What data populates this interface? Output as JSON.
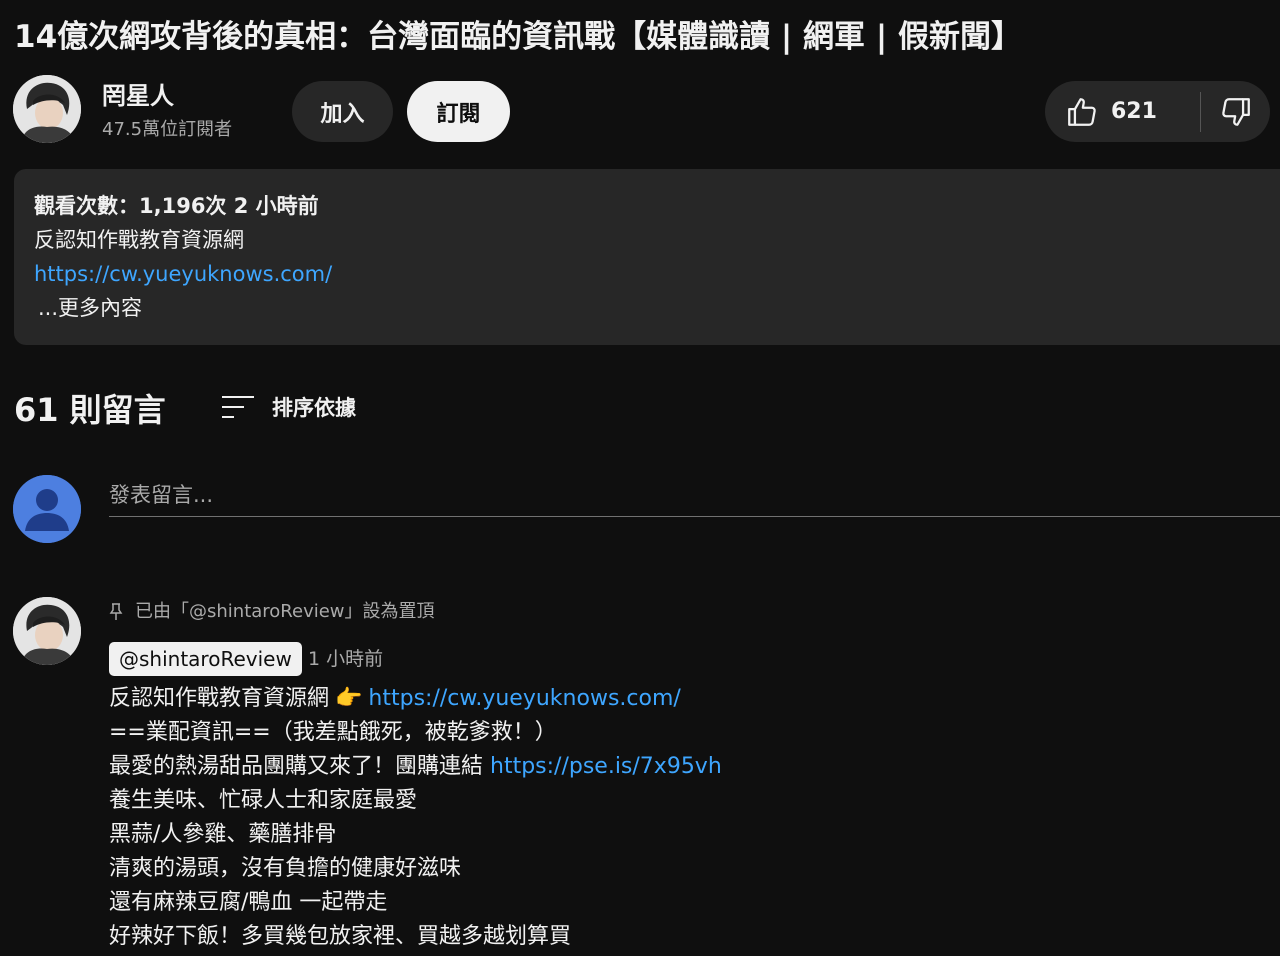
{
  "video": {
    "title": "14億次網攻背後的真相：台灣面臨的資訊戰【媒體識讀 | 網軍 | 假新聞】"
  },
  "channel": {
    "name": "罔星人",
    "subscribers": "47.5萬位訂閱者",
    "join_label": "加入",
    "subscribe_label": "訂閱"
  },
  "actions": {
    "like_count": "621",
    "like_icon": "thumbs-up-icon",
    "dislike_icon": "thumbs-down-icon"
  },
  "description": {
    "meta": "觀看次數：1,196次  2 小時前",
    "text": "反認知作戰教育資源網",
    "link": "https://cw.yueyuknows.com/",
    "more_label": "...更多內容"
  },
  "comments": {
    "count_label": "61 則留言",
    "sort_label": "排序依據",
    "input_placeholder": "發表留言...",
    "pinned_comment": {
      "pinned_note": "已由「@shintaroReview」設為置頂",
      "author": "@shintaroReview",
      "time": "1 小時前",
      "line1_text": "反認知作戰教育資源網",
      "line1_emoji": "👉",
      "line1_link": "https://cw.yueyuknows.com/",
      "line2": "==業配資訊==（我差點餓死，被乾爹救！）",
      "line3_text": "最愛的熱湯甜品團購又來了！團購連結 ",
      "line3_link": "https://pse.is/7x95vh",
      "line4": "養生美味、忙碌人士和家庭最愛",
      "line5": "黑蒜/人參雞、藥膳排骨",
      "line6": "清爽的湯頭，沒有負擔的健康好滋味",
      "line7": "還有麻辣豆腐/鴨血 一起帶走",
      "line8": "好辣好下飯！多買幾包放家裡、買越多越划算買"
    }
  },
  "colors": {
    "background": "#0f0f0f",
    "surface": "#272727",
    "link": "#3ea6ff",
    "text": "#f1f1f1",
    "secondary_text": "#aaaaaa"
  }
}
